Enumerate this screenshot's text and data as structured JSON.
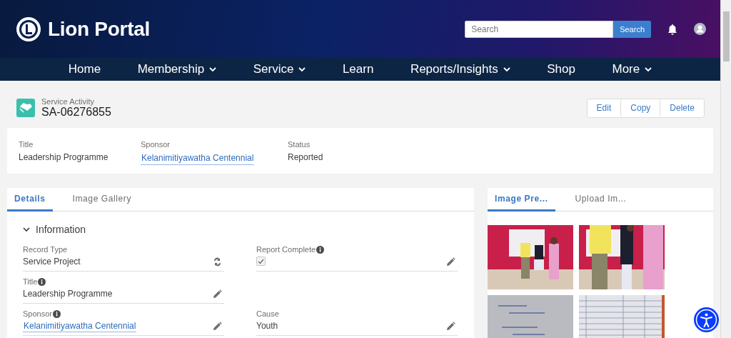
{
  "header": {
    "title": "Lion Portal",
    "search": {
      "placeholder": "Search"
    },
    "search_button": "Search"
  },
  "nav": [
    {
      "label": "Home",
      "menu": false
    },
    {
      "label": "Membership",
      "menu": true
    },
    {
      "label": "Service",
      "menu": true
    },
    {
      "label": "Learn",
      "menu": false
    },
    {
      "label": "Reports/Insights",
      "menu": true
    },
    {
      "label": "Shop",
      "menu": false
    },
    {
      "label": "More",
      "menu": true
    }
  ],
  "record": {
    "object": "Service Activity",
    "name": "SA-06276855",
    "actions": [
      "Edit",
      "Copy",
      "Delete"
    ]
  },
  "highlights": [
    {
      "label": "Title",
      "value": "Leadership Programme",
      "kind": "text"
    },
    {
      "label": "Sponsor",
      "value": "Kelanimitiyawatha Centennial",
      "kind": "link"
    },
    {
      "label": "Status",
      "value": "Reported",
      "kind": "text"
    }
  ],
  "details": {
    "tabs": [
      {
        "label": "Details",
        "selected": true
      },
      {
        "label": "Image Gallery",
        "selected": false
      }
    ],
    "section": {
      "title": "Information",
      "expanded": true
    },
    "rows": [
      {
        "left": {
          "label": "Record Type",
          "info": false,
          "kind": "record_type",
          "value": "Service Project"
        },
        "right": {
          "label": "Report Complete",
          "info": true,
          "kind": "checkbox",
          "checked": true,
          "editable": true
        }
      },
      {
        "left": {
          "label": "Title",
          "info": true,
          "kind": "text",
          "value": "Leadership Programme",
          "editable": true
        }
      },
      {
        "left": {
          "label": "Sponsor",
          "info": true,
          "kind": "link",
          "value": "Kelanimitiyawatha Centennial",
          "editable": true
        },
        "right": {
          "label": "Cause",
          "info": false,
          "kind": "text",
          "value": "Youth",
          "editable": true
        }
      }
    ]
  },
  "images": {
    "tabs": [
      {
        "label": "Image Pre...",
        "selected": true
      },
      {
        "label": "Upload Im...",
        "selected": false
      }
    ]
  }
}
